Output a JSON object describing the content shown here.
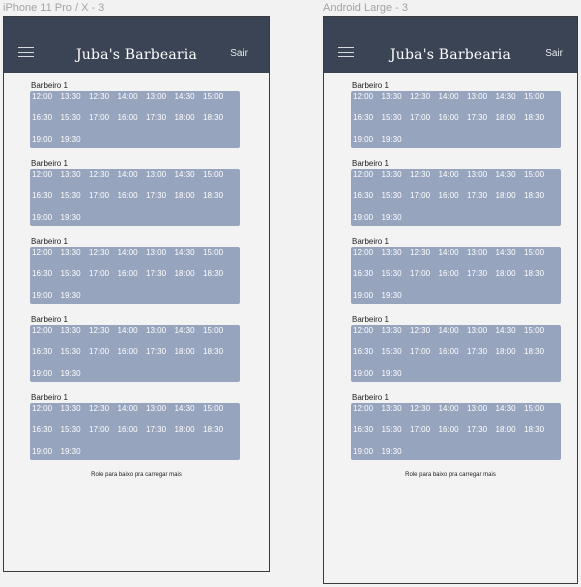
{
  "frames": [
    {
      "label": "iPhone 11 Pro / X - 3",
      "header": {
        "brand": "Juba's Barbearia",
        "logout_label": "Sair"
      },
      "barbers": [
        {
          "name": "Barbeiro 1",
          "slots": [
            "12:00",
            "13:30",
            "12:30",
            "14:00",
            "13:00",
            "14:30",
            "15:00",
            "16:30",
            "15:30",
            "17:00",
            "16:00",
            "17:30",
            "18:00",
            "18:30",
            "19:00",
            "19:30"
          ]
        },
        {
          "name": "Barbeiro 1",
          "slots": [
            "12:00",
            "13:30",
            "12:30",
            "14:00",
            "13:00",
            "14:30",
            "15:00",
            "16:30",
            "15:30",
            "17:00",
            "16:00",
            "17:30",
            "18:00",
            "18:30",
            "19:00",
            "19:30"
          ]
        },
        {
          "name": "Barbeiro 1",
          "slots": [
            "12:00",
            "13:30",
            "12:30",
            "14:00",
            "13:00",
            "14:30",
            "15:00",
            "16:30",
            "15:30",
            "17:00",
            "16:00",
            "17:30",
            "18:00",
            "18:30",
            "19:00",
            "19:30"
          ]
        },
        {
          "name": "Barbeiro 1",
          "slots": [
            "12:00",
            "13:30",
            "12:30",
            "14:00",
            "13:00",
            "14:30",
            "15:00",
            "16:30",
            "15:30",
            "17:00",
            "16:00",
            "17:30",
            "18:00",
            "18:30",
            "19:00",
            "19:30"
          ]
        },
        {
          "name": "Barbeiro 1",
          "slots": [
            "12:00",
            "13:30",
            "12:30",
            "14:00",
            "13:00",
            "14:30",
            "15:00",
            "16:30",
            "15:30",
            "17:00",
            "16:00",
            "17:30",
            "18:00",
            "18:30",
            "19:00",
            "19:30"
          ]
        }
      ],
      "load_more": "Role para baixo pra carregar mais"
    },
    {
      "label": "Android Large - 3",
      "header": {
        "brand": "Juba's Barbearia",
        "logout_label": "Sair"
      },
      "barbers": [
        {
          "name": "Barbeiro 1",
          "slots": [
            "12:00",
            "13:30",
            "12:30",
            "14:00",
            "13:00",
            "14:30",
            "15:00",
            "16:30",
            "15:30",
            "17:00",
            "16:00",
            "17:30",
            "18:00",
            "18:30",
            "19:00",
            "19:30"
          ]
        },
        {
          "name": "Barbeiro 1",
          "slots": [
            "12:00",
            "13:30",
            "12:30",
            "14:00",
            "13:00",
            "14:30",
            "15:00",
            "16:30",
            "15:30",
            "17:00",
            "16:00",
            "17:30",
            "18:00",
            "18:30",
            "19:00",
            "19:30"
          ]
        },
        {
          "name": "Barbeiro 1",
          "slots": [
            "12:00",
            "13:30",
            "12:30",
            "14:00",
            "13:00",
            "14:30",
            "15:00",
            "16:30",
            "15:30",
            "17:00",
            "16:00",
            "17:30",
            "18:00",
            "18:30",
            "19:00",
            "19:30"
          ]
        },
        {
          "name": "Barbeiro 1",
          "slots": [
            "12:00",
            "13:30",
            "12:30",
            "14:00",
            "13:00",
            "14:30",
            "15:00",
            "16:30",
            "15:30",
            "17:00",
            "16:00",
            "17:30",
            "18:00",
            "18:30",
            "19:00",
            "19:30"
          ]
        },
        {
          "name": "Barbeiro 1",
          "slots": [
            "12:00",
            "13:30",
            "12:30",
            "14:00",
            "13:00",
            "14:30",
            "15:00",
            "16:30",
            "15:30",
            "17:00",
            "16:00",
            "17:30",
            "18:00",
            "18:30",
            "19:00",
            "19:30"
          ]
        }
      ],
      "load_more": "Role para baixo pra carregar mais"
    }
  ],
  "theme": {
    "header_bg": "#3a4454",
    "slot_card_bg": "#97a4bd",
    "frame_bg": "#f3f3f3",
    "canvas_bg": "#f2f2f2",
    "menu_icon": "hamburger-menu-icon"
  }
}
